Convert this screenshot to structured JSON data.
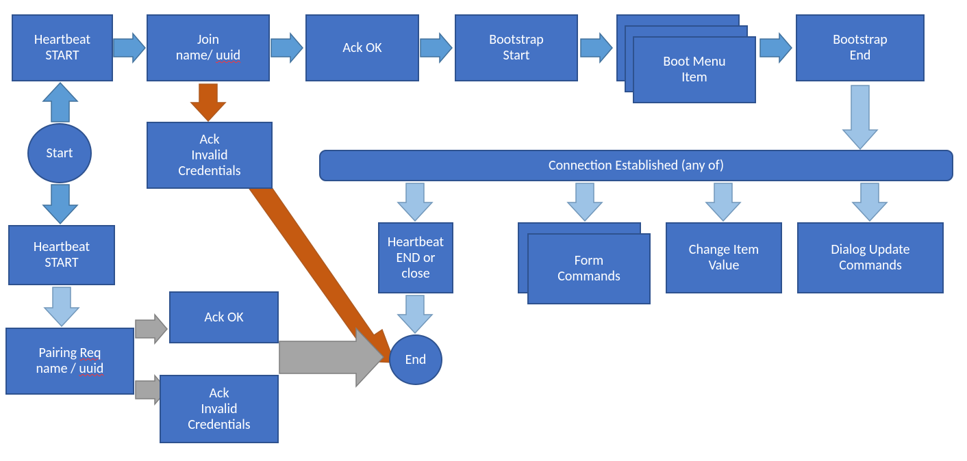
{
  "colors": {
    "box_fill": "#4472C4",
    "box_stroke": "#2E528F",
    "arrow_blue_fill": "#5B9BD5",
    "arrow_blue_stroke": "#41719C",
    "arrow_light_fill": "#9DC3E6",
    "arrow_light_stroke": "#7197BA",
    "arrow_orange_fill": "#C55A11",
    "arrow_orange_stroke": "#AE5A21",
    "arrow_gray_fill": "#A5A5A5",
    "arrow_gray_stroke": "#7F7F7F"
  },
  "nodes": {
    "hb_start_top": {
      "label_lines": [
        "Heartbeat",
        "START"
      ]
    },
    "join": {
      "label_prefix": "Join ",
      "label_mid": "name/ ",
      "label_uuid": "uuid"
    },
    "ack_ok_top": {
      "label": "Ack OK"
    },
    "bootstrap_start": {
      "label_lines": [
        "Bootstrap",
        "Start"
      ]
    },
    "boot_menu_item": {
      "label_lines": [
        "Boot Menu",
        "Item"
      ]
    },
    "bootstrap_end": {
      "label_lines": [
        "Bootstrap",
        "End"
      ]
    },
    "start": {
      "label": "Start"
    },
    "ack_invalid_top": {
      "label_lines": [
        "Ack",
        "Invalid",
        "Credentials"
      ]
    },
    "hb_start_left": {
      "label_lines": [
        "Heartbeat",
        "START"
      ]
    },
    "pairing_req": {
      "label_prefix": "Pairing ",
      "label_req": "Req",
      "label_mid": "name / ",
      "label_uuid": "uuid"
    },
    "ack_ok_bottom": {
      "label": "Ack OK"
    },
    "ack_invalid_bot": {
      "label_lines": [
        "Ack",
        "Invalid",
        "Credentials"
      ]
    },
    "conn_est": {
      "label": "Connection Established (any of)"
    },
    "hb_end": {
      "label_lines": [
        "Heartbeat",
        "END or",
        "close"
      ]
    },
    "form_cmds": {
      "label_lines": [
        "Form",
        "Commands"
      ]
    },
    "change_item": {
      "label_lines": [
        "Change Item",
        "Value"
      ]
    },
    "dialog_cmds": {
      "label_lines": [
        "Dialog Update",
        "Commands"
      ]
    },
    "end": {
      "label": "End"
    }
  }
}
